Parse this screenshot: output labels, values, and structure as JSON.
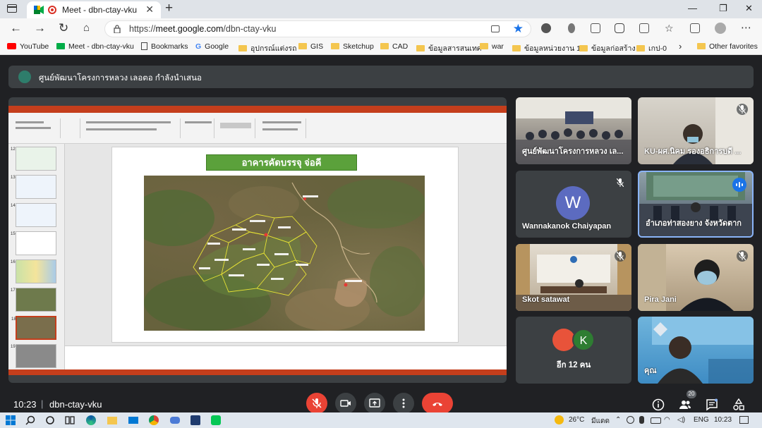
{
  "browser": {
    "tab_title": "Meet - dbn-ctay-vku",
    "tab_close": "✕",
    "new_tab": "+",
    "window_controls": [
      "—",
      "❐",
      "✕"
    ],
    "url_prefix": "https://",
    "url_host": "meet.google.com",
    "url_path": "/dbn-ctay-vku",
    "bookmarks": [
      {
        "label": "YouTube",
        "icon": "youtube-icon"
      },
      {
        "label": "Meet - dbn-ctay-vku",
        "icon": "meet-icon"
      },
      {
        "label": "Bookmarks",
        "icon": "page-icon"
      },
      {
        "label": "Google",
        "icon": "google-icon"
      },
      {
        "label": "อุปกรณ์แต่งรถ",
        "icon": "folder-icon"
      },
      {
        "label": "GIS",
        "icon": "folder-icon"
      },
      {
        "label": "Sketchup",
        "icon": "folder-icon"
      },
      {
        "label": "CAD",
        "icon": "folder-icon"
      },
      {
        "label": "ข้อมูลสารสนเทศ",
        "icon": "folder-icon"
      },
      {
        "label": "war",
        "icon": "folder-icon"
      },
      {
        "label": "ข้อมูลหน่วยงาน 1",
        "icon": "folder-icon"
      },
      {
        "label": "ข้อมูลก่อสร้าง",
        "icon": "folder-icon"
      },
      {
        "label": "เกป-0",
        "icon": "folder-icon"
      }
    ],
    "bookmarks_more": "›",
    "other_favorites": "Other favorites"
  },
  "meet": {
    "presenting_banner": "ศูนย์พัฒนาโครงการหลวง เลอตอ กำลังนำเสนอ",
    "slide_title": "อาคารคัดบรรจุ จ่อคี",
    "slide_numbers": [
      "12",
      "13",
      "14",
      "15",
      "16",
      "17",
      "18",
      "19"
    ],
    "participants": [
      {
        "name": "ศูนย์พัฒนาโครงการหลวง เล...",
        "muted": false
      },
      {
        "name": "KU-ผศ.นิคม รองอธิการบดี ...",
        "muted": true
      },
      {
        "name": "Wannakanok Chaiyapan",
        "initial": "W",
        "muted": true
      },
      {
        "name": "อำเภอท่าสองยาง จังหวัดตาก",
        "muted": false,
        "speaking": true
      },
      {
        "name": "Skot satawat",
        "muted": true
      },
      {
        "name": "Pira Jani",
        "muted": true
      },
      {
        "name": "คุณ",
        "muted": false
      }
    ],
    "others_initial": "K",
    "others_count": "อีก 12 คน",
    "clock": "10:23",
    "separator": "|",
    "meeting_code": "dbn-ctay-vku",
    "people_count": "20"
  },
  "taskbar": {
    "weather": "26°C",
    "weather_desc": "มีแดด",
    "language": "ENG",
    "time": "10:23"
  },
  "colors": {
    "meet_bg": "#202124",
    "tile_bg": "#3c4043",
    "hangup_red": "#ea4335",
    "ppt_orange": "#c43e1c",
    "slide_title_green": "#5ba13b",
    "active_outline": "#8ab4f8"
  }
}
